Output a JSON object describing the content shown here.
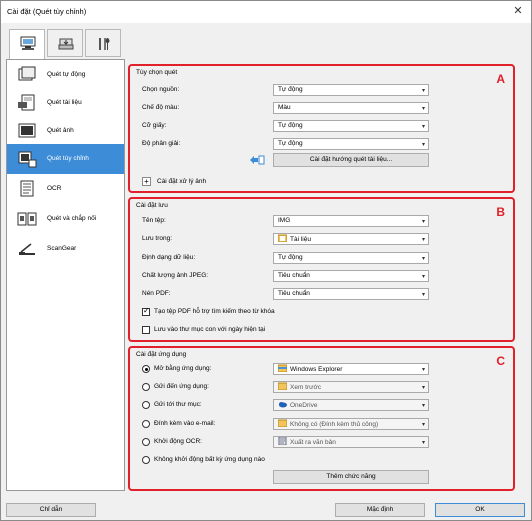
{
  "window": {
    "title": "Cài đặt (Quét tùy chỉnh)",
    "close_glyph": "✕"
  },
  "sidebar": {
    "items": [
      {
        "label": "Quét tự động",
        "icon": "auto-scan-icon"
      },
      {
        "label": "Quét tài liệu",
        "icon": "document-scan-icon"
      },
      {
        "label": "Quét ảnh",
        "icon": "photo-scan-icon"
      },
      {
        "label": "Quét tùy chỉnh",
        "icon": "custom-scan-icon",
        "active": true
      },
      {
        "label": "OCR",
        "icon": "ocr-icon"
      },
      {
        "label": "Quét và chắp nối",
        "icon": "stitch-scan-icon"
      },
      {
        "label": "ScanGear",
        "icon": "scangear-icon"
      }
    ]
  },
  "scan_options": {
    "title": "Tùy chọn quét",
    "marker": "A",
    "rows": [
      {
        "label": "Chọn nguồn:",
        "value": "Tự động"
      },
      {
        "label": "Chế độ màu:",
        "value": "Màu"
      },
      {
        "label": "Cỡ giấy:",
        "value": "Tự động"
      },
      {
        "label": "Độ phân giải:",
        "value": "Tự động"
      }
    ],
    "orientation_button": "Cài đặt hướng quét tài liệu...",
    "image_processing": "Cài đặt xử lý ảnh",
    "expand_glyph": "+"
  },
  "save_settings": {
    "title": "Cài đặt lưu",
    "marker": "B",
    "rows": [
      {
        "label": "Tên tệp:",
        "value": "IMG"
      },
      {
        "label": "Lưu trong:",
        "value": "Tài liệu"
      },
      {
        "label": "Định dạng dữ liệu:",
        "value": "Tự động"
      },
      {
        "label": "Chất lượng ảnh JPEG:",
        "value": "Tiêu chuẩn"
      },
      {
        "label": "Nén PDF:",
        "value": "Tiêu chuẩn"
      }
    ],
    "checkboxes": [
      {
        "label": "Tạo tệp PDF hỗ trợ tìm kiếm theo từ khóa",
        "checked": true
      },
      {
        "label": "Lưu vào thư mục con với ngày hiện tại",
        "checked": false
      }
    ]
  },
  "app_settings": {
    "title": "Cài đặt ứng dụng",
    "marker": "C",
    "rows": [
      {
        "label": "Mở bằng ứng dụng:",
        "value": "Windows Explorer",
        "selected": true,
        "enabled": true
      },
      {
        "label": "Gửi đến ứng dụng:",
        "value": "Xem trước",
        "selected": false,
        "enabled": false
      },
      {
        "label": "Gửi tới thư mục:",
        "value": "OneDrive",
        "selected": false,
        "enabled": false
      },
      {
        "label": "Đính kèm vào e-mail:",
        "value": "Không có (Đính kèm thủ công)",
        "selected": false,
        "enabled": false
      },
      {
        "label": "Khởi động OCR:",
        "value": "Xuất ra văn bản",
        "selected": false,
        "enabled": false
      },
      {
        "label": "Không khởi động bất kỳ ứng dụng nào",
        "value": null,
        "selected": false,
        "enabled": false
      }
    ],
    "more_functions_button": "Thêm chức năng"
  },
  "dropdown_arrow": "▾",
  "footer": {
    "help": "Chỉ dẫn",
    "defaults": "Mặc định",
    "ok": "OK"
  },
  "colors": {
    "accent": "#3c8cd8",
    "marker": "#e0202a"
  }
}
